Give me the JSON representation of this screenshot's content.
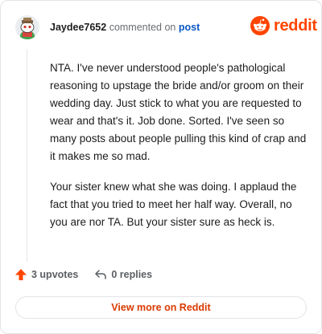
{
  "header": {
    "username": "Jaydee7652",
    "verb": "commented on",
    "target": "post",
    "avatar_icon": "snoo-avatar-icon"
  },
  "brand": {
    "icon": "reddit-snoo-icon",
    "name": "reddit",
    "color": "#ff4500"
  },
  "comment": {
    "paragraphs": [
      "NTA. I've never understood people's pathological reasoning to upstage the bride and/or groom on their wedding day. Just stick to what you are requested to wear and that's it. Job done. Sorted. I've seen so many posts about people pulling this kind of crap and it makes me so mad.",
      "Your sister knew what she was doing. I applaud the fact that you tried to meet her half way. Overall, no you are nor TA. But your sister sure as heck is."
    ]
  },
  "actions": {
    "upvotes_label": "3 upvotes",
    "upvote_icon": "upvote-arrow-icon",
    "upvote_color": "#ff4500",
    "replies_label": "0 replies",
    "reply_icon": "reply-arrow-icon"
  },
  "footer": {
    "view_more_label": "View more on Reddit",
    "accent": "#d93a00"
  }
}
